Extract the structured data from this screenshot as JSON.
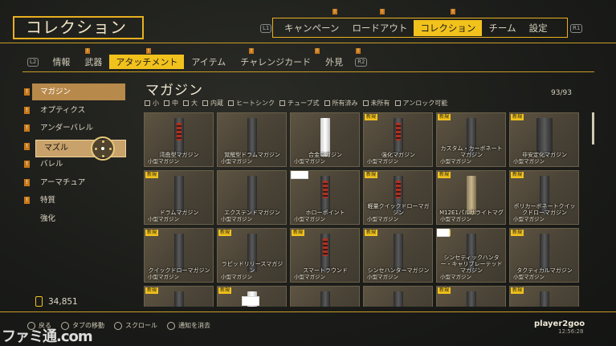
{
  "header": {
    "title": "コレクション",
    "l1": "L1",
    "r1": "R1",
    "tabs": [
      {
        "label": "キャンペーン"
      },
      {
        "label": "ロードアウト"
      },
      {
        "label": "コレクション",
        "active": true
      },
      {
        "label": "チーム"
      },
      {
        "label": "設定"
      }
    ]
  },
  "subtabs": {
    "l2": "L2",
    "r2": "R2",
    "items": [
      {
        "label": "情報"
      },
      {
        "label": "武器"
      },
      {
        "label": "アタッチメント",
        "active": true
      },
      {
        "label": "アイテム"
      },
      {
        "label": "チャレンジカード"
      },
      {
        "label": "外見"
      }
    ]
  },
  "sidebar": {
    "items": [
      {
        "label": "マガジン",
        "new": true,
        "active": true
      },
      {
        "label": "オプティクス",
        "new": true
      },
      {
        "label": "アンダーバレル",
        "new": true
      },
      {
        "label": "マズル",
        "new": true,
        "selected": true
      },
      {
        "label": "バレル",
        "new": true
      },
      {
        "label": "アーマチュア",
        "new": true
      },
      {
        "label": "特質",
        "new": true
      },
      {
        "label": "強化",
        "new": false
      }
    ]
  },
  "currency": {
    "value": "34,851",
    "icon": "credit-icon"
  },
  "section": {
    "title": "マガジン",
    "count": "93/93"
  },
  "filters": [
    "小",
    "中",
    "大",
    "内蔵",
    "ヒートシンク",
    "チューブ式",
    "所有済み",
    "未所有",
    "アンロック可能"
  ],
  "new_label": "新規",
  "cards": [
    {
      "name": "湾曲型マガジン",
      "sub": "小型マガジン",
      "new": false,
      "style": "red"
    },
    {
      "name": "覚醒型ドラムマガジン",
      "sub": "小型マガジン",
      "new": false,
      "style": ""
    },
    {
      "name": "合金マガジン",
      "sub": "小型マガジン",
      "new": false,
      "style": "white"
    },
    {
      "name": "強化マガジン",
      "sub": "小型マガジン",
      "new": true,
      "style": "red"
    },
    {
      "name": "カスタム・カーボネートマガジン",
      "sub": "小型マガジン",
      "new": true,
      "style": ""
    },
    {
      "name": "非安定化マガジン",
      "sub": "小型マガジン",
      "new": true,
      "style": "wide"
    },
    {
      "name": "ドラムマガジン",
      "sub": "小型マガジン",
      "new": true,
      "style": ""
    },
    {
      "name": "エクステンドマガジン",
      "sub": "小型マガジン",
      "new": false,
      "style": ""
    },
    {
      "name": "ホローポイント",
      "sub": "小型マガジン",
      "new": false,
      "style": "red"
    },
    {
      "name": "軽量クイックドローマガジン",
      "sub": "小型マガジン",
      "new": true,
      "style": "red"
    },
    {
      "name": "M12E1パルサライトマグ",
      "sub": "小型マガジン",
      "new": true,
      "style": "tan"
    },
    {
      "name": "ポリカーボネートクイックドローマガジン",
      "sub": "小型マガジン",
      "new": true,
      "style": ""
    },
    {
      "name": "クイックドローマガジン",
      "sub": "小型マガジン",
      "new": true,
      "style": ""
    },
    {
      "name": "ラピッドリリースマガジン",
      "sub": "小型マガジン",
      "new": true,
      "style": ""
    },
    {
      "name": "スマートラウンド",
      "sub": "小型マガジン",
      "new": true,
      "style": "red"
    },
    {
      "name": "シンセハンターマガジン",
      "sub": "小型マガジン",
      "new": true,
      "style": ""
    },
    {
      "name": "シンセティックハンター・キャリブレーテッドマガジン",
      "sub": "小型マガジン",
      "new": true,
      "style": ""
    },
    {
      "name": "タクティカルマガジン",
      "sub": "小型マガジン",
      "new": true,
      "style": ""
    },
    {
      "name": "",
      "sub": "",
      "new": true,
      "style": ""
    },
    {
      "name": "",
      "sub": "",
      "new": true,
      "style": "white"
    },
    {
      "name": "",
      "sub": "",
      "new": false,
      "style": ""
    },
    {
      "name": "",
      "sub": "",
      "new": false,
      "style": ""
    },
    {
      "name": "",
      "sub": "",
      "new": true,
      "style": ""
    },
    {
      "name": "",
      "sub": "",
      "new": true,
      "style": ""
    }
  ],
  "footer": {
    "hints": [
      {
        "button": "○",
        "label": "戻る"
      },
      {
        "button": "L",
        "label": "タブの移動"
      },
      {
        "button": "R",
        "label": "スクロール"
      },
      {
        "button": "△",
        "label": "通知を消去"
      }
    ],
    "player": "player2goo",
    "clock": "12:56:28"
  },
  "watermark": "ファミ通.com",
  "colors": {
    "accent": "#f2c21c",
    "rule": "#c89b24",
    "badge": "#c87818"
  }
}
